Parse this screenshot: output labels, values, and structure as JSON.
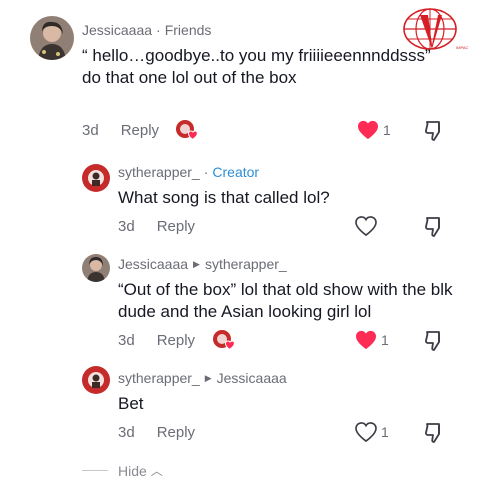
{
  "comments": [
    {
      "username": "Jessicaaaa",
      "badge": "Friends",
      "text": "“ hello…goodbye..to you my friiiieeennnddsss” do that one lol out of the box",
      "date": "3d",
      "reply_label": "Reply",
      "likes": "1"
    },
    {
      "username": "sytherapper_",
      "badge": "Creator",
      "text": "What song is that called lol?",
      "date": "3d",
      "reply_label": "Reply"
    },
    {
      "username": "Jessicaaaa",
      "reply_to": "sytherapper_",
      "text": "“Out of the box” lol that old show with the blk dude and the Asian looking girl lol",
      "date": "3d",
      "reply_label": "Reply",
      "likes": "1"
    },
    {
      "username": "sytherapper_",
      "reply_to": "Jessicaaaa",
      "text": "Bet",
      "date": "3d",
      "reply_label": "Reply",
      "likes": "1"
    }
  ],
  "hide_label": "Hide",
  "colors": {
    "liked_heart": "#fe2c55",
    "creator_badge": "#2c8fd6",
    "meta_text": "#6b6d76"
  },
  "icons": {
    "heart": "heart-icon",
    "dislike": "thumbs-down-icon",
    "reply_arrow": "triangle-right-icon",
    "logo": "globe-logo-icon"
  }
}
